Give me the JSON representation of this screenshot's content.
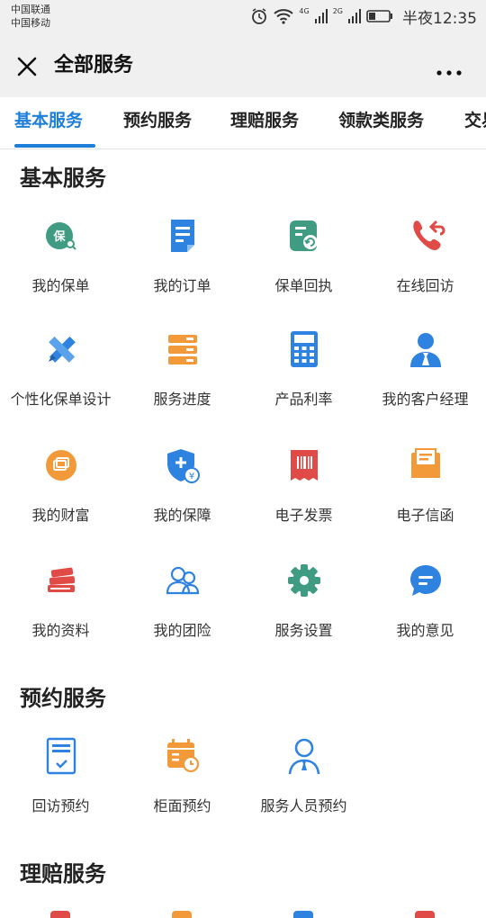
{
  "status_bar": {
    "carrier_1": "中国联通",
    "carrier_2": "中国移动",
    "network_1": "4G",
    "network_2": "2G",
    "time": "半夜12:35"
  },
  "app_bar": {
    "title": "全部服务"
  },
  "tabs": [
    {
      "label": "基本服务",
      "active": true
    },
    {
      "label": "预约服务",
      "active": false
    },
    {
      "label": "理赔服务",
      "active": false
    },
    {
      "label": "领款类服务",
      "active": false
    },
    {
      "label": "交易",
      "active": false
    }
  ],
  "sections": [
    {
      "title": "基本服务",
      "items": [
        {
          "label": "我的保单",
          "icon": "policy-badge-icon",
          "glyph": "保"
        },
        {
          "label": "我的订单",
          "icon": "order-document-icon"
        },
        {
          "label": "保单回执",
          "icon": "receipt-return-icon"
        },
        {
          "label": "在线回访",
          "icon": "phone-callback-icon"
        },
        {
          "label": "个性化保单设计",
          "icon": "pencil-ruler-icon"
        },
        {
          "label": "服务进度",
          "icon": "progress-stack-icon"
        },
        {
          "label": "产品利率",
          "icon": "calculator-icon"
        },
        {
          "label": "我的客户经理",
          "icon": "manager-person-icon"
        },
        {
          "label": "我的财富",
          "icon": "wealth-icon"
        },
        {
          "label": "我的保障",
          "icon": "shield-yuan-icon"
        },
        {
          "label": "电子发票",
          "icon": "invoice-icon"
        },
        {
          "label": "电子信函",
          "icon": "envelope-icon"
        },
        {
          "label": "我的资料",
          "icon": "books-icon"
        },
        {
          "label": "我的团险",
          "icon": "group-people-icon"
        },
        {
          "label": "服务设置",
          "icon": "gear-icon"
        },
        {
          "label": "我的意见",
          "icon": "chat-bubble-icon"
        }
      ]
    },
    {
      "title": "预约服务",
      "items": [
        {
          "label": "回访预约",
          "icon": "clipboard-check-icon"
        },
        {
          "label": "柜面预约",
          "icon": "calendar-clock-icon"
        },
        {
          "label": "服务人员预约",
          "icon": "staff-person-icon"
        }
      ]
    },
    {
      "title": "理赔服务",
      "items": []
    }
  ],
  "colors": {
    "accent": "#1d7fd9",
    "green": "#3f9c82",
    "blue": "#2e82e0",
    "red": "#e04b47",
    "orange": "#f29a3a"
  }
}
